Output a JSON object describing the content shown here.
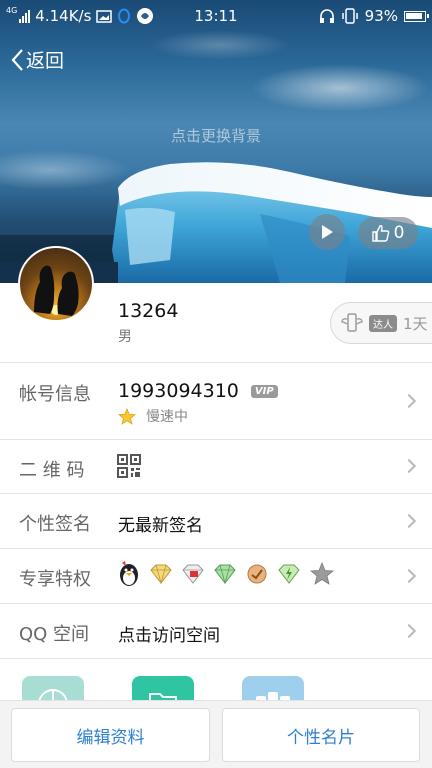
{
  "status_bar": {
    "network_type": "4G",
    "speed": "4.14K/s",
    "time": "13:11",
    "battery": "93%"
  },
  "header": {
    "back_label": "返回",
    "bg_hint": "点击更换背景",
    "like_count": "0"
  },
  "profile": {
    "name": "13264",
    "gender": "男",
    "talent_badge": "达人",
    "talent_days": "1天"
  },
  "rows": {
    "account": {
      "label": "帐号信息",
      "value": "1993094310",
      "vip": "VIP",
      "speed": "慢速中"
    },
    "qrcode": {
      "label": "二 维 码"
    },
    "signature": {
      "label": "个性签名",
      "value": "无最新签名"
    },
    "privileges": {
      "label": "专享特权",
      "icons": [
        "qq-penguin-icon",
        "yellow-diamond-icon",
        "red-diamond-icon",
        "green-diamond-icon",
        "orange-badge-icon",
        "green-bolt-diamond-icon",
        "gray-star-icon"
      ]
    },
    "qzone": {
      "label": "QQ 空间",
      "value": "点击访问空间"
    }
  },
  "bottom": {
    "edit_profile": "编辑资料",
    "personal_card": "个性名片"
  },
  "colors": {
    "accent_blue": "#2f7fd1",
    "label_gray": "#666666",
    "tile_teal": "#a8ddd3",
    "tile_green": "#2fc4a2",
    "tile_blue": "#9ed0ee"
  }
}
